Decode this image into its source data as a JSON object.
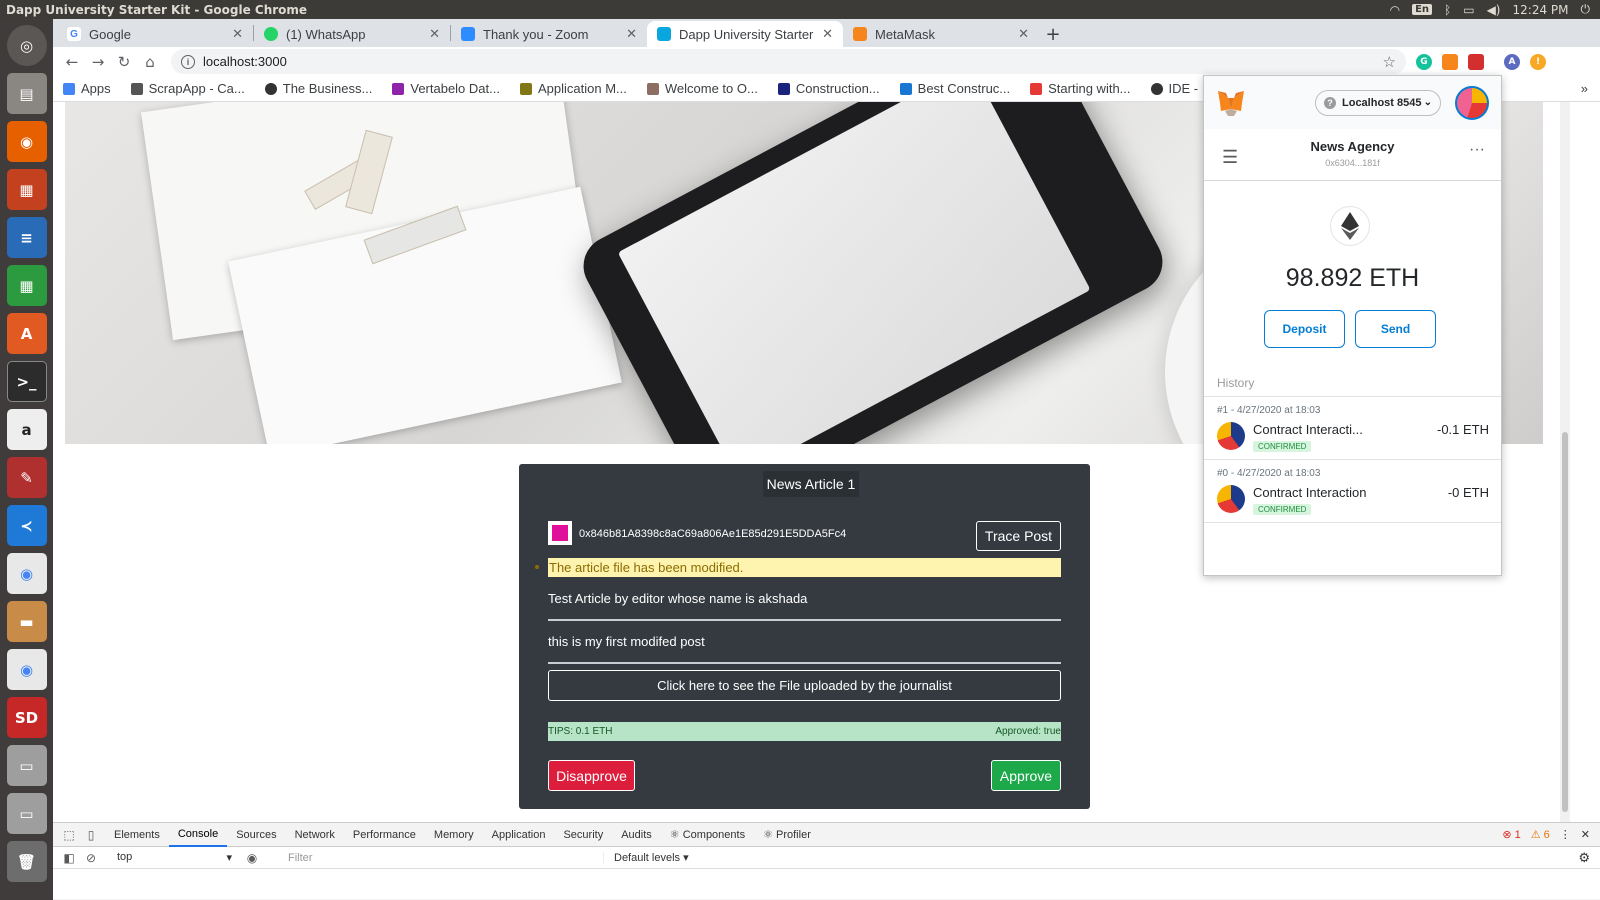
{
  "os": {
    "window_title": "Dapp University Starter Kit - Google Chrome",
    "keyboard": "En",
    "time": "12:24 PM"
  },
  "tabs": [
    {
      "label": "Google",
      "color": "#4285f4",
      "glyph": "G"
    },
    {
      "label": "(1) WhatsApp",
      "color": "#25d366",
      "glyph": "●"
    },
    {
      "label": "Thank you - Zoom",
      "color": "#2d8cff",
      "glyph": "▪"
    },
    {
      "label": "Dapp University Starter K",
      "color": "#0aa6e0",
      "glyph": "◆"
    },
    {
      "label": "MetaMask",
      "color": "#f6851b",
      "glyph": "🦊"
    }
  ],
  "address_bar": {
    "url": "localhost:3000"
  },
  "bookmarks": [
    {
      "label": "Apps",
      "color": "#4285f4"
    },
    {
      "label": "ScrapApp - Ca...",
      "color": "#555555"
    },
    {
      "label": "The Business...",
      "color": "#333333"
    },
    {
      "label": "Vertabelo Dat...",
      "color": "#8e24aa"
    },
    {
      "label": "Application M...",
      "color": "#827717"
    },
    {
      "label": "Welcome to O...",
      "color": "#8d6e63"
    },
    {
      "label": "Construction...",
      "color": "#1a237e"
    },
    {
      "label": "Best Construc...",
      "color": "#1976d2"
    },
    {
      "label": "Starting with...",
      "color": "#e53935"
    },
    {
      "label": "IDE -",
      "color": "#333333"
    }
  ],
  "article": {
    "header": "News Article 1",
    "author_address": "0x846b81A8398c8aC69a806Ae1E85d291E5DDA5Fc4",
    "trace_button": "Trace Post",
    "warning": "The article file has been modified.",
    "title": "Test Article by editor whose name is akshada",
    "body": "this is my first modifed post",
    "file_button": "Click here to see the File uploaded by the journalist",
    "tips": "TIPS: 0.1 ETH",
    "approved": "Approved: true",
    "disapprove_button": "Disapprove",
    "approve_button": "Approve"
  },
  "metamask": {
    "network": "Localhost 8545",
    "account_name": "News Agency",
    "account_address": "0x6304...181f",
    "balance": "98.892 ETH",
    "deposit_button": "Deposit",
    "send_button": "Send",
    "history_label": "History",
    "transactions": [
      {
        "date": "#1 - 4/27/2020 at 18:03",
        "name": "Contract Interacti...",
        "amount": "-0.1 ETH",
        "status": "CONFIRMED"
      },
      {
        "date": "#0 - 4/27/2020 at 18:03",
        "name": "Contract Interaction",
        "amount": "-0 ETH",
        "status": "CONFIRMED"
      }
    ]
  },
  "devtools": {
    "tabs": [
      "Elements",
      "Console",
      "Sources",
      "Network",
      "Performance",
      "Memory",
      "Application",
      "Security",
      "Audits",
      "⚛ Components",
      "⚛ Profiler"
    ],
    "active_tab": "Console",
    "errors": "1",
    "warnings": "6",
    "context": "top",
    "filter_placeholder": "Filter",
    "levels": "Default levels ▾"
  }
}
